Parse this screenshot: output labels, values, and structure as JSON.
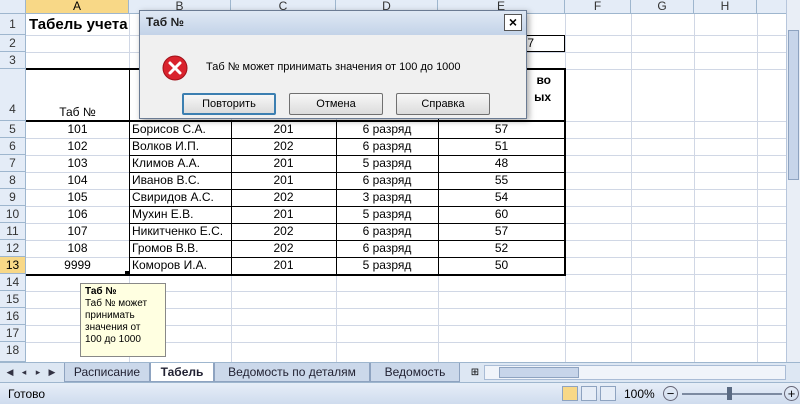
{
  "columns": [
    "A",
    "B",
    "C",
    "D",
    "E",
    "F",
    "G",
    "H"
  ],
  "rows": [
    "1",
    "2",
    "3",
    "4",
    "5",
    "6",
    "7",
    "8",
    "9",
    "10",
    "11",
    "12",
    "13",
    "14",
    "15",
    "16",
    "17",
    "18"
  ],
  "sheet": {
    "title": "Табель учета",
    "row2_e_partial": "7",
    "header_tab": "Таб №",
    "header_e_partial_1": "во",
    "header_e_partial_2": "ых",
    "data": [
      {
        "tab": "101",
        "name": "Борисов С.А.",
        "c": "201",
        "d": "6 разряд",
        "e": "57"
      },
      {
        "tab": "102",
        "name": "Волков И.П.",
        "c": "202",
        "d": "6 разряд",
        "e": "51"
      },
      {
        "tab": "103",
        "name": "Климов А.А.",
        "c": "201",
        "d": "5 разряд",
        "e": "48"
      },
      {
        "tab": "104",
        "name": "Иванов В.С.",
        "c": "201",
        "d": "6 разряд",
        "e": "55"
      },
      {
        "tab": "105",
        "name": "Свиридов А.С.",
        "c": "202",
        "d": "3 разряд",
        "e": "54"
      },
      {
        "tab": "106",
        "name": "Мухин Е.В.",
        "c": "201",
        "d": "5 разряд",
        "e": "60"
      },
      {
        "tab": "107",
        "name": "Никитченко Е.С.",
        "c": "202",
        "d": "6 разряд",
        "e": "57"
      },
      {
        "tab": "108",
        "name": "Громов В.В.",
        "c": "202",
        "d": "6 разряд",
        "e": "52"
      },
      {
        "tab": "9999",
        "name": "Коморов И.А.",
        "c": "201",
        "d": "5 разряд",
        "e": "50"
      }
    ]
  },
  "dialog": {
    "title": "Таб №",
    "close": "×",
    "message": "Таб № может принимать значения от 100 до 1000",
    "buttons": {
      "retry": "Повторить",
      "cancel": "Отмена",
      "help": "Справка"
    },
    "icon": "error-icon"
  },
  "tooltip": {
    "title": "Таб №",
    "lines": [
      "Таб № может",
      "принимать",
      "значения от",
      "100 до 1000"
    ]
  },
  "tabs": [
    "Расписание",
    "Табель",
    "Ведомость по деталям",
    "Ведомость"
  ],
  "active_tab": "Табель",
  "status": {
    "ready": "Готово",
    "zoom": "100%"
  },
  "colors": {
    "header_bg": "#e4ecf7",
    "header_selected": "#f8d887",
    "grid": "#d0d7e5",
    "dialog_bg": "#f0f0f0",
    "tooltip_bg": "#ffffe1"
  }
}
